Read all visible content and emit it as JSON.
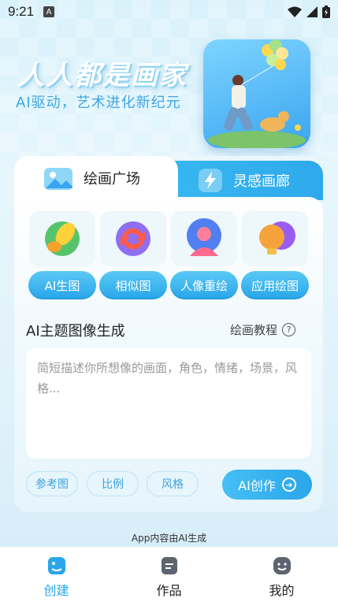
{
  "status_bar": {
    "time": "9:21",
    "notification_icon": "A"
  },
  "hero": {
    "title": "人人都是画家",
    "subtitle": "AI驱动，艺术进化新纪元"
  },
  "tabs": [
    {
      "label": "绘画广场",
      "active": true,
      "icon": "landscape-image-icon"
    },
    {
      "label": "灵感画廊",
      "active": false,
      "icon": "lightning-icon"
    }
  ],
  "tools": [
    {
      "label": "AI生图",
      "icon": "brush-icon"
    },
    {
      "label": "相似图",
      "icon": "refresh-icon"
    },
    {
      "label": "人像重绘",
      "icon": "person-icon"
    },
    {
      "label": "应用绘图",
      "icon": "bulb-icon"
    }
  ],
  "section": {
    "title": "AI主题图像生成",
    "tutorial": "绘画教程"
  },
  "prompt": {
    "placeholder": "简短描述你所想像的画面，角色，情绪，场景，风格..."
  },
  "chips": [
    "参考图",
    "比例",
    "风格"
  ],
  "create_button": "AI创作",
  "disclaimer": "App内容由AI生成",
  "bottom_nav": [
    {
      "label": "创建",
      "active": true
    },
    {
      "label": "作品",
      "active": false
    },
    {
      "label": "我的",
      "active": false
    }
  ],
  "colors": {
    "accent": "#2aa6ea",
    "accent_light": "#5cc8f5"
  }
}
